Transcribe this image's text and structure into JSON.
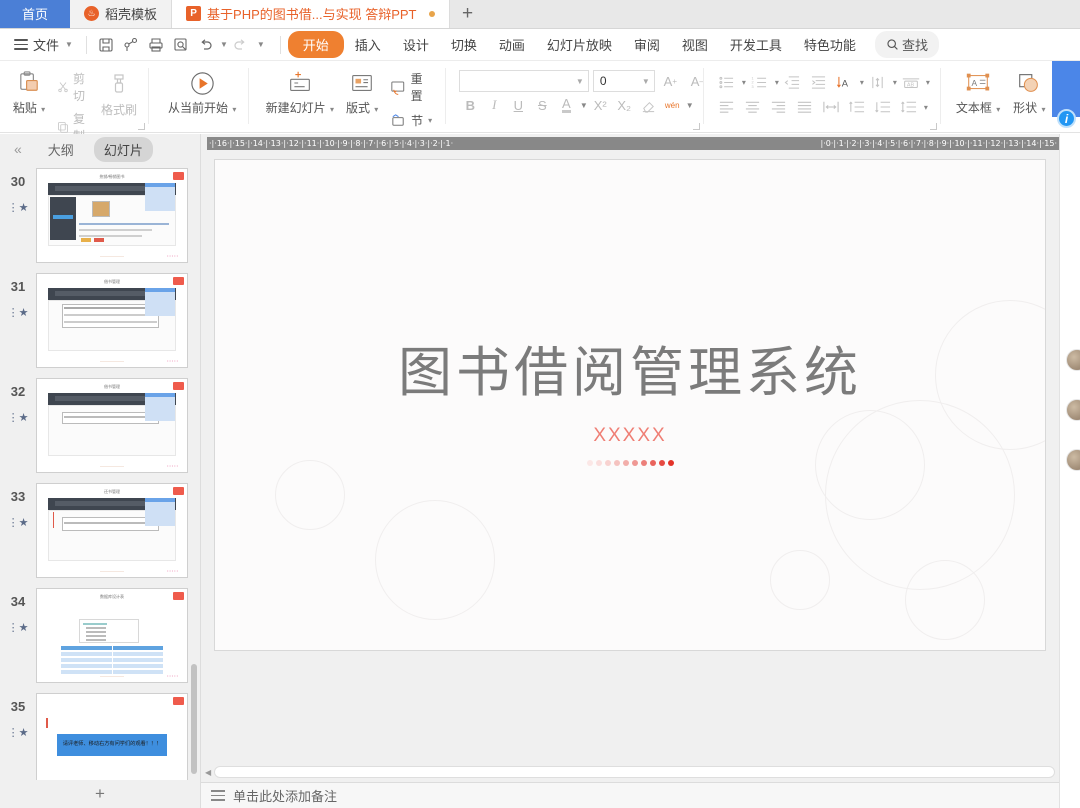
{
  "tabbar": {
    "home_tab": "首页",
    "template_tab": "稻壳模板",
    "doc_tab": "基于PHP的图书借...与实现 答辩PPT",
    "new_tab": "+"
  },
  "menubar": {
    "file": "文件",
    "quick_icons": [
      "save-icon",
      "share-icon",
      "print-icon",
      "print-preview-icon",
      "undo-icon",
      "redo-icon",
      "more-icon"
    ],
    "items": [
      "开始",
      "插入",
      "设计",
      "切换",
      "动画",
      "幻灯片放映",
      "审阅",
      "视图",
      "开发工具",
      "特色功能"
    ],
    "active_item": "开始",
    "search": "查找"
  },
  "ribbon": {
    "paste": "粘贴",
    "cut": "剪切",
    "copy": "复制",
    "format_painter": "格式刷",
    "start_from_current": "从当前开始",
    "new_slide": "新建幻灯片",
    "layout": "版式",
    "reset": "重置",
    "section": "节",
    "font_name": "",
    "font_name_placeholder": "",
    "font_size": "0",
    "bold": "B",
    "italic": "I",
    "underline": "U",
    "strikethrough": "S",
    "font_color": "A",
    "superscript": "X²",
    "subscript": "X₂",
    "clear_format": "clear-format-icon",
    "pinyin": "wén",
    "textbox": "文本框",
    "shape": "形状",
    "arrange": "arrange-icon"
  },
  "sidebar": {
    "collapse": "«",
    "outline_tab": "大纲",
    "slides_tab": "幻灯片",
    "active_tab": "幻灯片",
    "add_slide": "+",
    "slides": [
      {
        "num": "30",
        "kind": "screenshot",
        "title": "热销/畅销图书"
      },
      {
        "num": "31",
        "kind": "table",
        "title": "借书管理"
      },
      {
        "num": "32",
        "kind": "table2",
        "title": "借书管理"
      },
      {
        "num": "33",
        "kind": "table3",
        "title": "还书管理"
      },
      {
        "num": "34",
        "kind": "datatable",
        "title": "数据库设计表"
      },
      {
        "num": "35",
        "kind": "thanks",
        "title": "请评老师、移动右方有问学们的观看！！！"
      }
    ]
  },
  "ruler": {
    "left_marks": "·|·16·|·15·|·14·|·13·|·12·|·11·|·10·|·9·|·8·|·7·|·6·|·5·|·4·|·3·|·2·|·1·",
    "right_marks": "|·0·|·1·|·2·|·3·|·4·|·5·|·6·|·7·|·8·|·9·|·10·|·11·|·12·|·13·|·14·|·15·"
  },
  "slide": {
    "title": "图书借阅管理系统",
    "subtitle": "XXXXX",
    "dot_count": 10,
    "title_color": "#7b7b7b",
    "subtitle_color": "#ef7e74"
  },
  "statusbar": {
    "notes_placeholder": "单击此处添加备注"
  },
  "colors": {
    "accent": "#ef8030",
    "tab_home_bg": "#4b7fd6",
    "active_tab_text": "#e8622a",
    "blue_panel": "#4b86e8"
  }
}
